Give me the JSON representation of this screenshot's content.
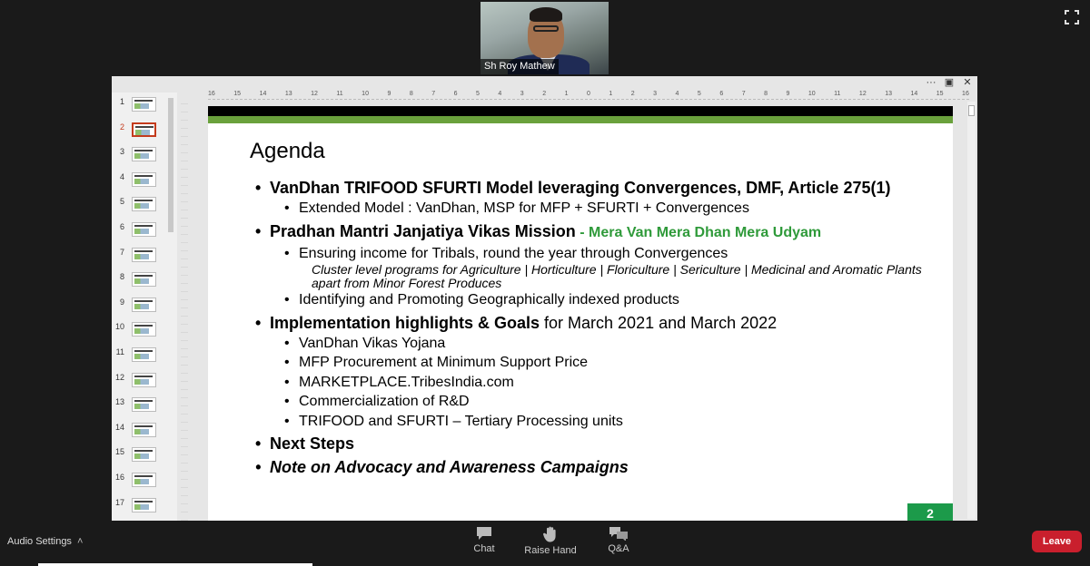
{
  "participant": {
    "name": "Sh Roy Mathew"
  },
  "share": {
    "ruler_ticks": [
      "16",
      "15",
      "14",
      "13",
      "12",
      "11",
      "10",
      "9",
      "8",
      "7",
      "6",
      "5",
      "4",
      "3",
      "2",
      "1",
      "0",
      "1",
      "2",
      "3",
      "4",
      "5",
      "6",
      "7",
      "8",
      "9",
      "10",
      "11",
      "12",
      "13",
      "14",
      "15",
      "16"
    ],
    "thumbnails": [
      "1",
      "2",
      "3",
      "4",
      "5",
      "6",
      "7",
      "8",
      "9",
      "10",
      "11",
      "12",
      "13",
      "14",
      "15",
      "16",
      "17"
    ],
    "active_slide": 2
  },
  "slide": {
    "title": "Agenda",
    "item1": "VanDhan TRIFOOD SFURTI Model leveraging Convergences, DMF, Article 275(1)",
    "item1_sub1": "Extended Model  : VanDhan, MSP for MFP  + SFURTI + Convergences",
    "item2": "Pradhan Mantri Janjatiya Vikas Mission",
    "item2_green": " - Mera Van Mera Dhan Mera Udyam",
    "item2_sub1": "Ensuring income for Tribals, round the year through Convergences",
    "item2_sub1_note": "Cluster level programs for Agriculture  | Horticulture | Floriculture  | Sericulture | Medicinal and Aromatic Plants apart from Minor Forest Produces",
    "item2_sub2": "Identifying and Promoting Geographically indexed products",
    "item3": "Implementation highlights & Goals",
    "item3_normal": " for March 2021 and March 2022",
    "item3_subs": [
      "VanDhan Vikas Yojana",
      "MFP Procurement at Minimum Support Price",
      "MARKETPLACE.TribesIndia.com",
      "Commercialization of R&D",
      "TRIFOOD and SFURTI – Tertiary Processing units"
    ],
    "item4": "Next Steps",
    "item5": "Note on Advocacy and Awareness Campaigns",
    "number": "2"
  },
  "toolbar": {
    "audio_settings": "Audio Settings",
    "chat": "Chat",
    "raise_hand": "Raise Hand",
    "qa": "Q&A",
    "leave": "Leave"
  },
  "colors": {
    "accent_green": "#6aa13c",
    "leave_red": "#c91f2d",
    "slide_number_bg": "#1c9a4a"
  }
}
